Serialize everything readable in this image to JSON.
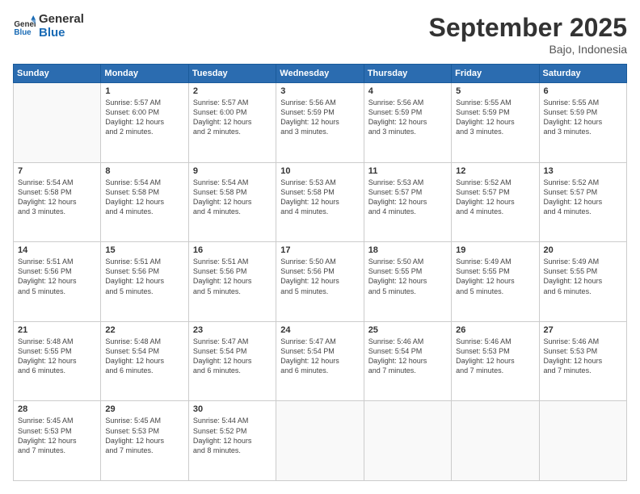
{
  "header": {
    "logo_text_general": "General",
    "logo_text_blue": "Blue",
    "month": "September 2025",
    "location": "Bajo, Indonesia"
  },
  "days_of_week": [
    "Sunday",
    "Monday",
    "Tuesday",
    "Wednesday",
    "Thursday",
    "Friday",
    "Saturday"
  ],
  "weeks": [
    [
      {
        "day": "",
        "data": ""
      },
      {
        "day": "1",
        "data": "Sunrise: 5:57 AM\nSunset: 6:00 PM\nDaylight: 12 hours\nand 2 minutes."
      },
      {
        "day": "2",
        "data": "Sunrise: 5:57 AM\nSunset: 6:00 PM\nDaylight: 12 hours\nand 2 minutes."
      },
      {
        "day": "3",
        "data": "Sunrise: 5:56 AM\nSunset: 5:59 PM\nDaylight: 12 hours\nand 3 minutes."
      },
      {
        "day": "4",
        "data": "Sunrise: 5:56 AM\nSunset: 5:59 PM\nDaylight: 12 hours\nand 3 minutes."
      },
      {
        "day": "5",
        "data": "Sunrise: 5:55 AM\nSunset: 5:59 PM\nDaylight: 12 hours\nand 3 minutes."
      },
      {
        "day": "6",
        "data": "Sunrise: 5:55 AM\nSunset: 5:59 PM\nDaylight: 12 hours\nand 3 minutes."
      }
    ],
    [
      {
        "day": "7",
        "data": "Sunrise: 5:54 AM\nSunset: 5:58 PM\nDaylight: 12 hours\nand 3 minutes."
      },
      {
        "day": "8",
        "data": "Sunrise: 5:54 AM\nSunset: 5:58 PM\nDaylight: 12 hours\nand 4 minutes."
      },
      {
        "day": "9",
        "data": "Sunrise: 5:54 AM\nSunset: 5:58 PM\nDaylight: 12 hours\nand 4 minutes."
      },
      {
        "day": "10",
        "data": "Sunrise: 5:53 AM\nSunset: 5:58 PM\nDaylight: 12 hours\nand 4 minutes."
      },
      {
        "day": "11",
        "data": "Sunrise: 5:53 AM\nSunset: 5:57 PM\nDaylight: 12 hours\nand 4 minutes."
      },
      {
        "day": "12",
        "data": "Sunrise: 5:52 AM\nSunset: 5:57 PM\nDaylight: 12 hours\nand 4 minutes."
      },
      {
        "day": "13",
        "data": "Sunrise: 5:52 AM\nSunset: 5:57 PM\nDaylight: 12 hours\nand 4 minutes."
      }
    ],
    [
      {
        "day": "14",
        "data": "Sunrise: 5:51 AM\nSunset: 5:56 PM\nDaylight: 12 hours\nand 5 minutes."
      },
      {
        "day": "15",
        "data": "Sunrise: 5:51 AM\nSunset: 5:56 PM\nDaylight: 12 hours\nand 5 minutes."
      },
      {
        "day": "16",
        "data": "Sunrise: 5:51 AM\nSunset: 5:56 PM\nDaylight: 12 hours\nand 5 minutes."
      },
      {
        "day": "17",
        "data": "Sunrise: 5:50 AM\nSunset: 5:56 PM\nDaylight: 12 hours\nand 5 minutes."
      },
      {
        "day": "18",
        "data": "Sunrise: 5:50 AM\nSunset: 5:55 PM\nDaylight: 12 hours\nand 5 minutes."
      },
      {
        "day": "19",
        "data": "Sunrise: 5:49 AM\nSunset: 5:55 PM\nDaylight: 12 hours\nand 5 minutes."
      },
      {
        "day": "20",
        "data": "Sunrise: 5:49 AM\nSunset: 5:55 PM\nDaylight: 12 hours\nand 6 minutes."
      }
    ],
    [
      {
        "day": "21",
        "data": "Sunrise: 5:48 AM\nSunset: 5:55 PM\nDaylight: 12 hours\nand 6 minutes."
      },
      {
        "day": "22",
        "data": "Sunrise: 5:48 AM\nSunset: 5:54 PM\nDaylight: 12 hours\nand 6 minutes."
      },
      {
        "day": "23",
        "data": "Sunrise: 5:47 AM\nSunset: 5:54 PM\nDaylight: 12 hours\nand 6 minutes."
      },
      {
        "day": "24",
        "data": "Sunrise: 5:47 AM\nSunset: 5:54 PM\nDaylight: 12 hours\nand 6 minutes."
      },
      {
        "day": "25",
        "data": "Sunrise: 5:46 AM\nSunset: 5:54 PM\nDaylight: 12 hours\nand 7 minutes."
      },
      {
        "day": "26",
        "data": "Sunrise: 5:46 AM\nSunset: 5:53 PM\nDaylight: 12 hours\nand 7 minutes."
      },
      {
        "day": "27",
        "data": "Sunrise: 5:46 AM\nSunset: 5:53 PM\nDaylight: 12 hours\nand 7 minutes."
      }
    ],
    [
      {
        "day": "28",
        "data": "Sunrise: 5:45 AM\nSunset: 5:53 PM\nDaylight: 12 hours\nand 7 minutes."
      },
      {
        "day": "29",
        "data": "Sunrise: 5:45 AM\nSunset: 5:53 PM\nDaylight: 12 hours\nand 7 minutes."
      },
      {
        "day": "30",
        "data": "Sunrise: 5:44 AM\nSunset: 5:52 PM\nDaylight: 12 hours\nand 8 minutes."
      },
      {
        "day": "",
        "data": ""
      },
      {
        "day": "",
        "data": ""
      },
      {
        "day": "",
        "data": ""
      },
      {
        "day": "",
        "data": ""
      }
    ]
  ]
}
